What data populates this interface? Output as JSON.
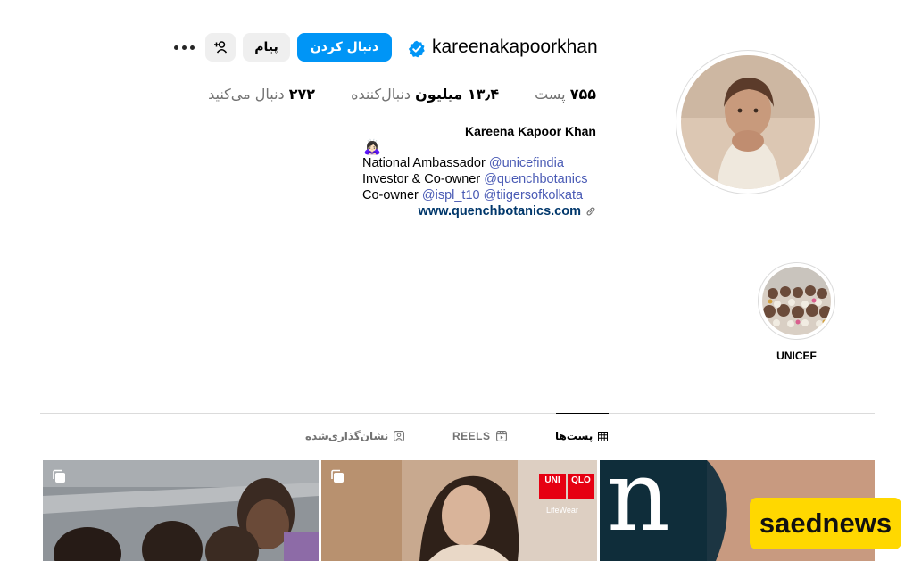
{
  "profile": {
    "username": "kareenakapoorkhan",
    "verified": true,
    "full_name": "Kareena Kapoor Khan",
    "emoji": "🙇🏻‍♀️",
    "actions": {
      "follow_label": "دنبال کردن",
      "message_label": "پیام",
      "add_user_icon": "person-add-icon",
      "more_icon": "more-horizontal-icon"
    },
    "stats": {
      "posts_value": "۷۵۵",
      "posts_label": "پست",
      "followers_value": "۱۳٫۴ میلیون",
      "followers_label": "دنبال‌کننده",
      "following_value": "۲۷۲",
      "following_label": "دنبال می‌کنید"
    },
    "bio": {
      "line1_text": "National Ambassador",
      "line1_mention": "@unicefindia",
      "line2_text": "Investor & Co-owner",
      "line2_mention": "@quenchbotanics",
      "line3_text": "Co-owner",
      "line3_mention1": "@ispl_t10",
      "line3_mention2": "@tiigersofkolkata",
      "link": "www.quenchbotanics.com"
    }
  },
  "highlights": [
    {
      "label": "UNICEF"
    }
  ],
  "tabs": {
    "posts": "پست‌ها",
    "reels": "REELS",
    "tagged": "نشان‌گذاری‌شده"
  },
  "grid": {
    "tile2_brand_line1": "UNI",
    "tile2_brand_line2": "QLO",
    "tile2_brand_sub": "LifeWear",
    "tile3_letter": "n"
  },
  "watermark": "saednews",
  "colors": {
    "accent": "#0095f6",
    "verified": "#0095f6",
    "mention": "#4a5bb5",
    "link": "#00376b",
    "muted": "#737373",
    "button_bg": "#efefef",
    "watermark_bg": "#ffd800"
  }
}
